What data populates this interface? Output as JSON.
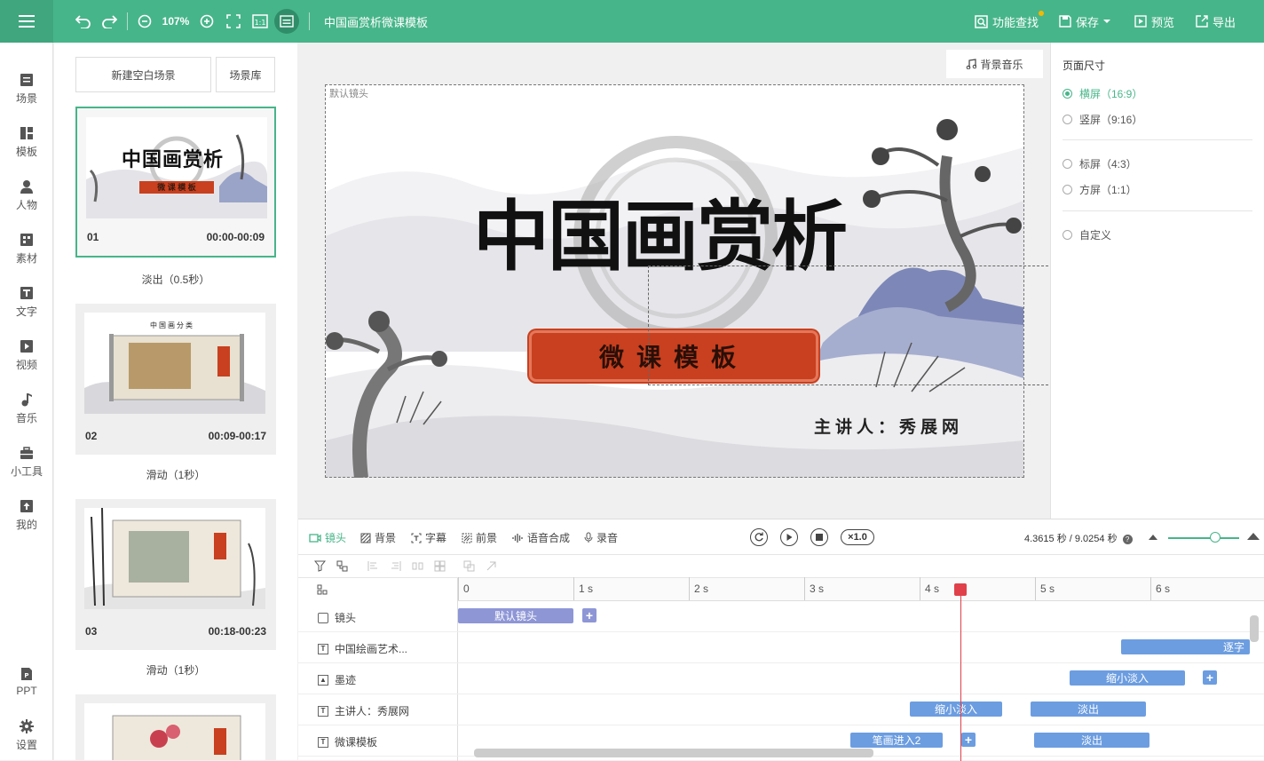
{
  "topbar": {
    "zoom": "107%",
    "doc_title": "中国画赏析微课模板",
    "feature_search": "功能查找",
    "save": "保存",
    "preview": "预览",
    "export": "导出"
  },
  "leftnav": {
    "items": [
      "场景",
      "模板",
      "人物",
      "素材",
      "文字",
      "视频",
      "音乐",
      "小工具",
      "我的"
    ],
    "bottom": [
      "PPT",
      "设置"
    ]
  },
  "scenes": {
    "new_blank": "新建空白场景",
    "library": "场景库",
    "list": [
      {
        "num": "01",
        "time": "00:00-00:09",
        "transition": "淡出（0.5秒）",
        "thumb_title": "中国画赏析",
        "thumb_sub": "微 课 模 板"
      },
      {
        "num": "02",
        "time": "00:09-00:17",
        "transition": "滑动（1秒）",
        "thumb_title": "中国画分类"
      },
      {
        "num": "03",
        "time": "00:18-00:23",
        "transition": "滑动（1秒）"
      }
    ]
  },
  "canvas": {
    "bgm": "背景音乐",
    "default_camera": "默认镜头",
    "title": "中国画赏析",
    "subtitle": "微课模板",
    "presenter": "主讲人：秀展网"
  },
  "page_size": {
    "title": "页面尺寸",
    "options": [
      "横屏（16:9）",
      "竖屏（9:16）",
      "标屏（4:3）",
      "方屏（1:1）",
      "自定义"
    ],
    "selected": "横屏（16:9）"
  },
  "timeline": {
    "tabs": [
      "镜头",
      "背景",
      "字幕",
      "前景",
      "语音合成",
      "录音"
    ],
    "speed": "×1.0",
    "time_current": "4.3615 秒",
    "time_total": "9.0254 秒",
    "time_sep": " / ",
    "ruler": [
      "0",
      "1 s",
      "2 s",
      "3 s",
      "4 s",
      "5 s",
      "6 s"
    ],
    "tracks": [
      {
        "name": "镜头",
        "icon": "camera-icon"
      },
      {
        "name": "中国绘画艺术...",
        "icon": "text-icon"
      },
      {
        "name": "墨迹",
        "icon": "image-icon"
      },
      {
        "name": "主讲人：秀展网",
        "icon": "text-icon"
      },
      {
        "name": "微课模板",
        "icon": "text-icon"
      }
    ],
    "clips": {
      "camera": "默认镜头",
      "t2": "逐字",
      "t3": "缩小淡入",
      "t4a": "缩小淡入",
      "t4b": "淡出",
      "t5a": "笔画进入2",
      "t5b": "淡出"
    }
  },
  "colors": {
    "accent": "#47b58a",
    "clip_purple": "#8e96d6",
    "clip_blue": "#6c9de0",
    "playhead": "#e0404a",
    "title_red": "#c8401f"
  }
}
